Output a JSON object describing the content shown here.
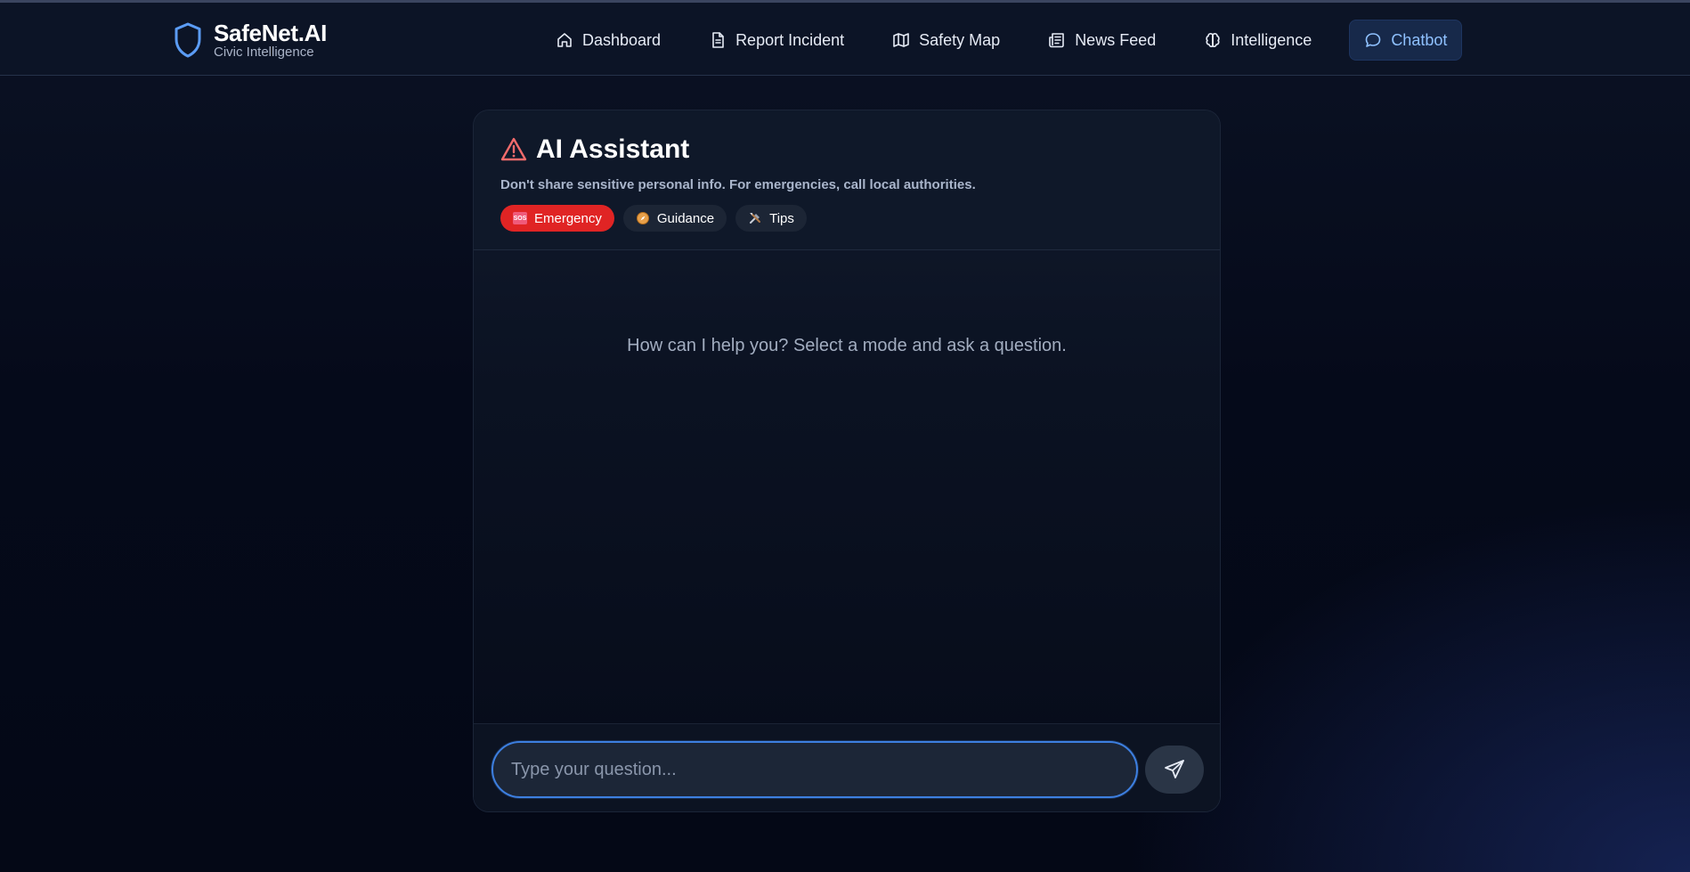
{
  "brand": {
    "name": "SafeNet.AI",
    "tagline": "Civic Intelligence",
    "icon": "shield-icon",
    "accent": "#5b9cf5"
  },
  "nav": {
    "items": [
      {
        "label": "Dashboard",
        "icon": "home-icon",
        "active": false
      },
      {
        "label": "Report Incident",
        "icon": "document-icon",
        "active": false
      },
      {
        "label": "Safety Map",
        "icon": "map-icon",
        "active": false
      },
      {
        "label": "News Feed",
        "icon": "newspaper-icon",
        "active": false
      },
      {
        "label": "Intelligence",
        "icon": "brain-icon",
        "active": false
      },
      {
        "label": "Chatbot",
        "icon": "chat-bubble-icon",
        "active": true
      }
    ],
    "active_color": "#8fc1ff"
  },
  "chat": {
    "title": "AI Assistant",
    "title_icon": "warning-triangle-icon",
    "warning_color": "#f26b6b",
    "disclaimer": "Don't share sensitive personal info. For emergencies, call local authorities.",
    "modes": [
      {
        "label": "Emergency",
        "icon": "sos-icon",
        "active": true
      },
      {
        "label": "Guidance",
        "icon": "compass-icon",
        "active": false
      },
      {
        "label": "Tips",
        "icon": "tools-icon",
        "active": false
      }
    ],
    "emergency_color": "#e02424",
    "empty_message": "How can I help you? Select a mode and ask a question.",
    "input": {
      "placeholder": "Type your question...",
      "value": ""
    },
    "send_icon": "send-icon"
  }
}
